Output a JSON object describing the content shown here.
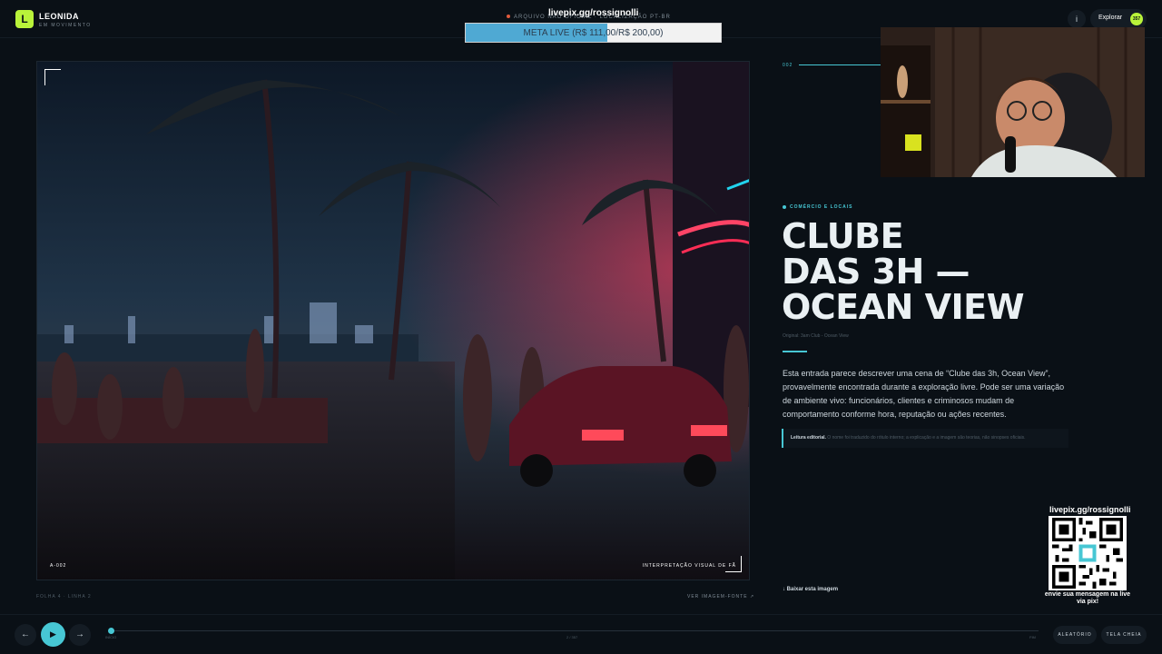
{
  "brand": {
    "name": "LEONIDA",
    "subtitle": "EM MOVIMENTO",
    "logo_letter": "L",
    "accent": "#b9f33a"
  },
  "header": {
    "archive_note": "ARQUIVO NÃO OFICIAL · LOCALIZAÇÃO PT-BR",
    "info_label": "i",
    "explore_label": "Explorar",
    "explore_count": "357"
  },
  "livepix": {
    "top_label": "livepix.gg/rossignolli",
    "goal_label": "META LIVE (R$ 111,00/R$ 200,00)",
    "goal_progress": 0.555,
    "qr_title": "livepix.gg/rossignolli",
    "qr_caption": "envie sua mensagem na live via pix!"
  },
  "image": {
    "code": "A-002",
    "interpretation": "INTERPRETAÇÃO VISUAL DE FÃ",
    "sheet": "FOLHA 4 · LINHA 2",
    "view_source": "VER IMAGEM-FONTE ↗"
  },
  "entry": {
    "number": "002",
    "category": "COMÉRCIO E LOCAIS",
    "title_lines": [
      "CLUBE",
      "DAS 3H —",
      "OCEAN VIEW"
    ],
    "original": "Original: 3am Club - Ocean View",
    "description": "Esta entrada parece descrever uma cena de “Clube das 3h, Ocean View”, provavelmente encontrada durante a exploração livre. Pode ser uma variação de ambiente vivo: funcionários, clientes e criminosos mudam de comportamento conforme hora, reputação ou ações recentes.",
    "editorial_label": "Leitura editorial.",
    "editorial_text": "O nome foi traduzido do rótulo interno; a explicação e a imagem são teorias, não sinopses oficiais.",
    "download": "↓ Baixar esta imagem",
    "accent": "#47c7d4"
  },
  "controls": {
    "prev": "←",
    "play": "▶",
    "next": "→",
    "track_start": "INÍCIO",
    "track_position": "2 / 357",
    "track_end": "FIM",
    "progress": 0.003,
    "random": "ALEATÓRIO",
    "fullscreen": "TELA CHEIA"
  }
}
